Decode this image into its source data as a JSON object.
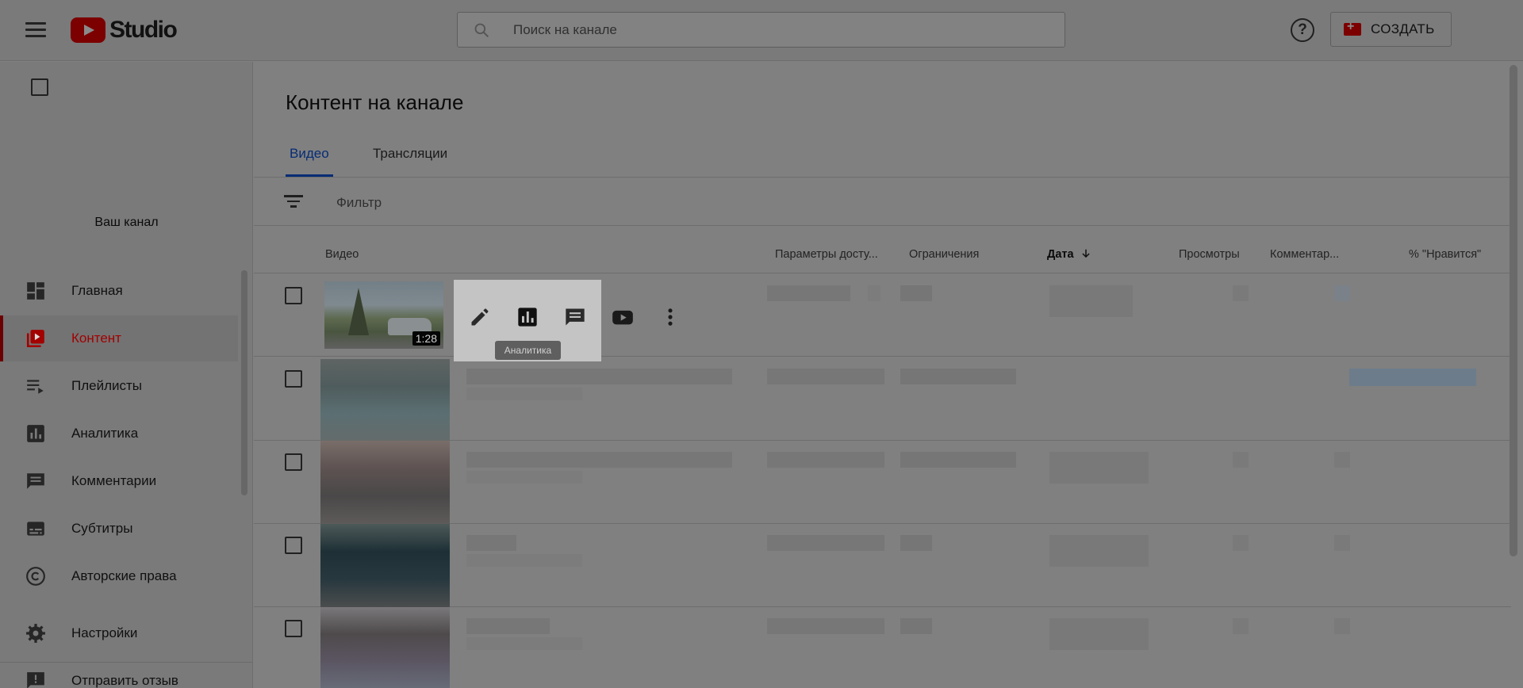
{
  "header": {
    "logo_text": "Studio",
    "search_placeholder": "Поиск на канале",
    "help_glyph": "?",
    "create_label": "СОЗДАТЬ"
  },
  "sidebar": {
    "channel_label": "Ваш канал",
    "items": [
      {
        "label": "Главная",
        "icon": "dashboard-icon"
      },
      {
        "label": "Контент",
        "icon": "content-icon",
        "active": true
      },
      {
        "label": "Плейлисты",
        "icon": "playlist-icon"
      },
      {
        "label": "Аналитика",
        "icon": "analytics-icon"
      },
      {
        "label": "Комментарии",
        "icon": "comments-icon"
      },
      {
        "label": "Субтитры",
        "icon": "subtitles-icon"
      },
      {
        "label": "Авторские права",
        "icon": "copyright-icon"
      },
      {
        "label": "Настройки",
        "icon": "settings-icon"
      },
      {
        "label": "Отправить отзыв",
        "icon": "feedback-icon"
      }
    ]
  },
  "main": {
    "title": "Контент на канале",
    "tabs": [
      {
        "label": "Видео",
        "active": true
      },
      {
        "label": "Трансляции"
      }
    ],
    "filter_placeholder": "Фильтр",
    "columns": {
      "video": "Видео",
      "visibility": "Параметры досту...",
      "restrictions": "Ограничения",
      "date": "Дата",
      "views": "Просмотры",
      "comments": "Комментар...",
      "likes": "% \"Нравится\""
    },
    "first_video": {
      "duration": "1:28"
    },
    "tooltip": "Аналитика"
  },
  "colors": {
    "accent_blue": "#062c75",
    "active_red": "#a30000",
    "overlay_gray": "#808080"
  }
}
